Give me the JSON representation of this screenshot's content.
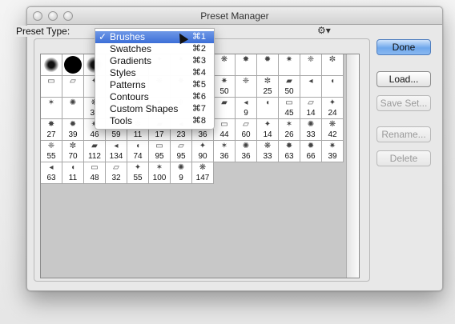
{
  "window": {
    "title": "Preset Manager"
  },
  "preset_type": {
    "label": "Preset Type:"
  },
  "buttons": {
    "done": "Done",
    "load": "Load...",
    "save_set": "Save Set...",
    "rename": "Rename...",
    "delete": "Delete"
  },
  "menu": {
    "items": [
      {
        "label": "Brushes",
        "shortcut": "⌘1",
        "checked": true
      },
      {
        "label": "Swatches",
        "shortcut": "⌘2"
      },
      {
        "label": "Gradients",
        "shortcut": "⌘3"
      },
      {
        "label": "Styles",
        "shortcut": "⌘4"
      },
      {
        "label": "Patterns",
        "shortcut": "⌘5"
      },
      {
        "label": "Contours",
        "shortcut": "⌘6"
      },
      {
        "label": "Custom Shapes",
        "shortcut": "⌘7"
      },
      {
        "label": "Tools",
        "shortcut": "⌘8"
      }
    ],
    "check_glyph": "✓"
  },
  "brushes": {
    "rows": [
      [
        "",
        "",
        "",
        "",
        "",
        "",
        "",
        "",
        "",
        "",
        "",
        "",
        "",
        ""
      ],
      [
        "",
        "",
        "",
        "",
        "",
        "",
        "",
        "",
        "50",
        "",
        "25",
        "50",
        "",
        ""
      ],
      [
        "",
        "",
        "36",
        "",
        "",
        "",
        "",
        "",
        "",
        "9",
        "",
        "45",
        "14",
        "24"
      ],
      [
        "27",
        "39",
        "46",
        "59",
        "11",
        "17",
        "23",
        "36",
        "44",
        "60",
        "14",
        "26",
        "33",
        "42"
      ],
      [
        "55",
        "70",
        "112",
        "134",
        "74",
        "95",
        "95",
        "90",
        "36",
        "36",
        "33",
        "63",
        "66",
        "39"
      ],
      [
        "63",
        "11",
        "48",
        "32",
        "55",
        "100",
        "9",
        "147"
      ]
    ]
  }
}
